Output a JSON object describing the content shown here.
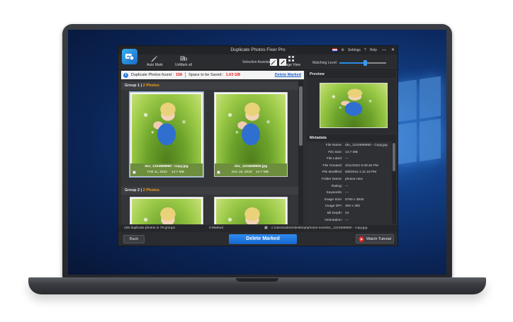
{
  "app": {
    "title": "Duplicate Photos Fixer Pro",
    "settings_label": "Settings",
    "help_label": "Help",
    "minimize": "—",
    "close": "✕"
  },
  "toolbar": {
    "auto_mark": "Auto Mark",
    "unmark_all": "UnMark all",
    "selection_assistant": "Selection Assistant",
    "image_view": "Image View",
    "matching_level": "Matching Level:",
    "matching_level_value": 0.55
  },
  "infobar": {
    "duplicates_label": "Duplicate Photos found :",
    "duplicates_value": "158",
    "space_label": "Space to be Saved :",
    "space_value": "1.63 GB",
    "delete_marked_link": "Delete Marked"
  },
  "groups": [
    {
      "title": "Group 1",
      "count": "2 Photos",
      "photos": [
        {
          "filename": "dsc_1224568960 - copy.jpg",
          "date": "Feb 11, 2022",
          "size": "14.7 MB"
        },
        {
          "filename": "dsc_1224568960.jpg",
          "date": "Dec 18, 2019",
          "size": "14.7 MB"
        }
      ]
    },
    {
      "title": "Group 2",
      "count": "2 Photos"
    }
  ],
  "panel": {
    "preview_label": "Preview",
    "metadata_label": "Metadata",
    "metadata": [
      {
        "key": "File Name:",
        "value": "dsc_1224568960 - Copy.jpg"
      },
      {
        "key": "File Size:",
        "value": "14.7 MB"
      },
      {
        "key": "File Label:",
        "value": "---"
      },
      {
        "key": "File Created:",
        "value": "2/11/2022 6:28:46 PM"
      },
      {
        "key": "File Modified:",
        "value": "6/8/2016 1:11:19 PM"
      },
      {
        "key": "Folder Name:",
        "value": "photos-new"
      },
      {
        "key": "Rating:",
        "value": "---"
      },
      {
        "key": "Keywords:",
        "value": "---"
      },
      {
        "key": "Image Size:",
        "value": "5760 x 3840"
      },
      {
        "key": "Image DPI:",
        "value": "300 x 300"
      },
      {
        "key": "Bit Depth:",
        "value": "24"
      },
      {
        "key": "Orientation:",
        "value": "---"
      }
    ]
  },
  "status": {
    "summary": "158 duplicate photos in 79 groups",
    "marked": "0 Marked",
    "path": "c:\\users\\admin\\desktop\\photos-new\\dsc_1224568960 - copy.jpg"
  },
  "footer": {
    "back": "Back",
    "delete_marked": "Delete Marked",
    "watch_tutorial": "Watch Tutorial"
  }
}
